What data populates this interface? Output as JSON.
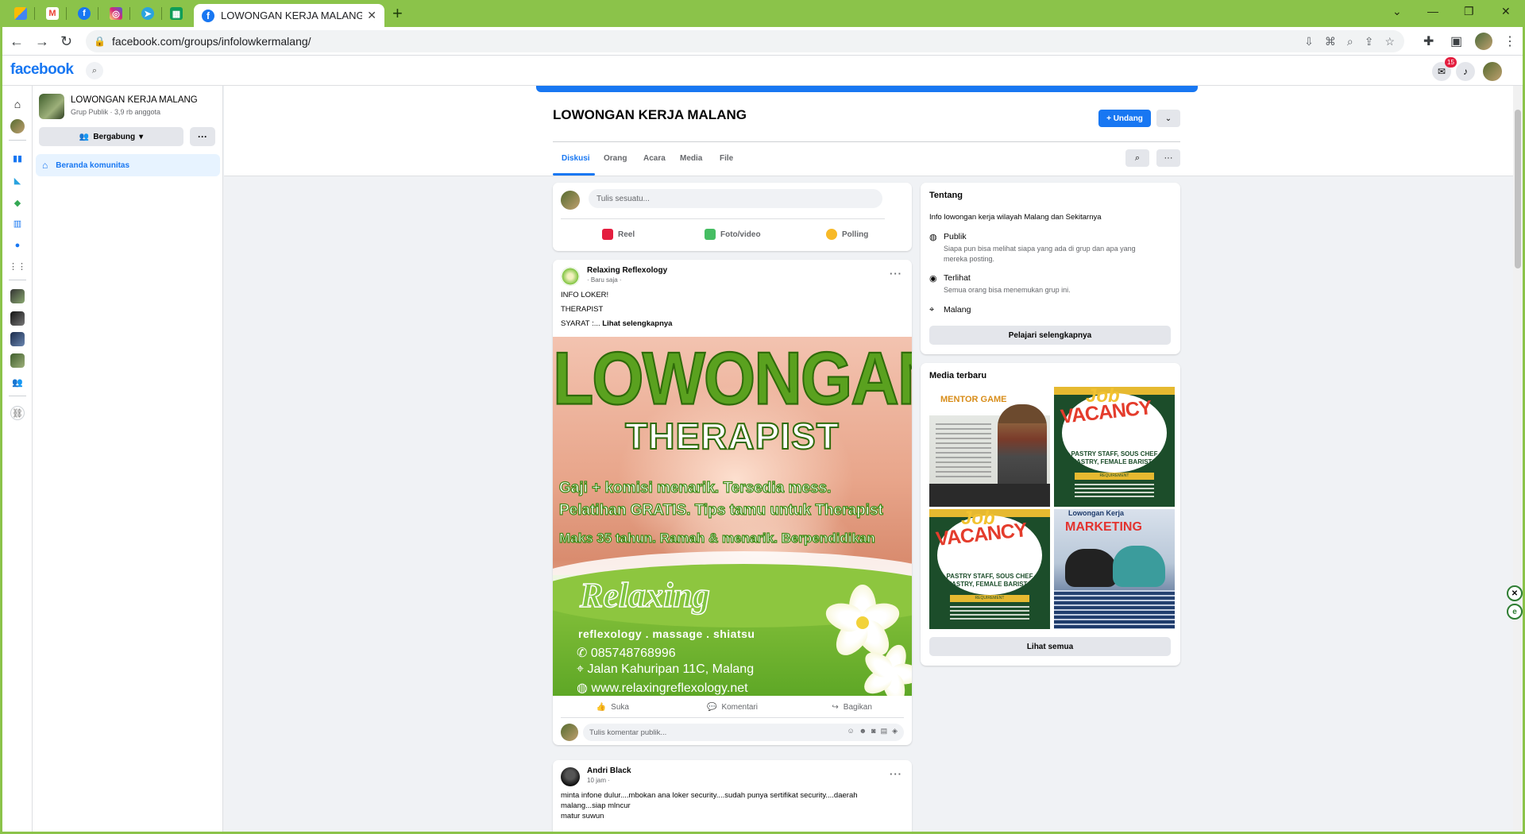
{
  "browser": {
    "active_tab_title": "LOWONGAN KERJA MALANG | Fa",
    "url": "facebook.com/groups/infolowkermalang/",
    "pinned_tabs": [
      {
        "icon": "google-ads-icon",
        "color": "#4285f4"
      },
      {
        "icon": "gmail-icon",
        "color": "#ea4335"
      },
      {
        "icon": "facebook-icon",
        "color": "#1877f2"
      },
      {
        "icon": "instagram-icon",
        "color": "#d62976"
      },
      {
        "icon": "telegram-icon",
        "color": "#2aa3df"
      },
      {
        "icon": "sheets-icon",
        "color": "#0f9d58"
      }
    ]
  },
  "fb": {
    "logo": "facebook",
    "notif_count": "15"
  },
  "group": {
    "name": "LOWONGAN KERJA MALANG",
    "meta": "Grup Publik · 3,9 rb anggota",
    "join_label": "Bergabung",
    "home_label": "Beranda komunitas",
    "invite_label": "+ Undang",
    "tabs": [
      "Diskusi",
      "Orang",
      "Acara",
      "Media",
      "File"
    ]
  },
  "composer": {
    "placeholder": "Tulis sesuatu...",
    "actions": [
      "Reel",
      "Foto/video",
      "Polling"
    ]
  },
  "post1": {
    "author": "Relaxing Reflexology",
    "time": "· Baru saja ·",
    "lines": [
      "INFO LOKER!",
      "THERAPIST",
      "SYARAT :..."
    ],
    "see_more": "Lihat selengkapnya",
    "poster": {
      "headline": "LOWONGAN",
      "role": "THERAPIST",
      "perks": [
        "Gaji + komisi menarik. Tersedia mess.",
        "Pelatihan GRATIS. Tips tamu untuk Therapist",
        "Maks 35 tahun. Ramah & menarik. Berpendidikan"
      ],
      "brand": "Relaxing",
      "services": "reflexology . massage . shiatsu",
      "phone": "085748768996",
      "address": "Jalan Kahuripan 11C, Malang",
      "website": "www.relaxingreflexology.net"
    },
    "actions": [
      "Suka",
      "Komentari",
      "Bagikan"
    ],
    "comment_placeholder": "Tulis komentar publik..."
  },
  "post2": {
    "author": "Andri Black",
    "time": "10 jam ·",
    "lines": [
      "minta infone dulur....mbokan ana loker security....sudah punya sertifikat security....daerah",
      "malang...siap mlncur",
      "matur suwun"
    ]
  },
  "about": {
    "title": "Tentang",
    "desc": "Info lowongan kerja wilayah Malang dan Sekitarnya",
    "public_title": "Publik",
    "public_desc": "Siapa pun bisa melihat siapa yang ada di grup dan apa yang mereka posting.",
    "visible_title": "Terlihat",
    "visible_desc": "Semua orang bisa menemukan grup ini.",
    "location": "Malang",
    "learn_more": "Pelajari selengkapnya"
  },
  "media": {
    "title": "Media terbaru",
    "see_all": "Lihat semua",
    "mentor_title": "MENTOR GAME",
    "job_word": "Job",
    "vacancy_word": "VACANCY",
    "vacancy_text": "PASTRY STAFF, SOUS CHEF PASTRY, FEMALE BARISTA",
    "requirement": "REQUIREMENT",
    "marketing_heading": "Lowongan Kerja",
    "marketing_title": "MARKETING"
  },
  "colors": {
    "brand": "#1877f2",
    "chrome": "#8bc34a"
  }
}
